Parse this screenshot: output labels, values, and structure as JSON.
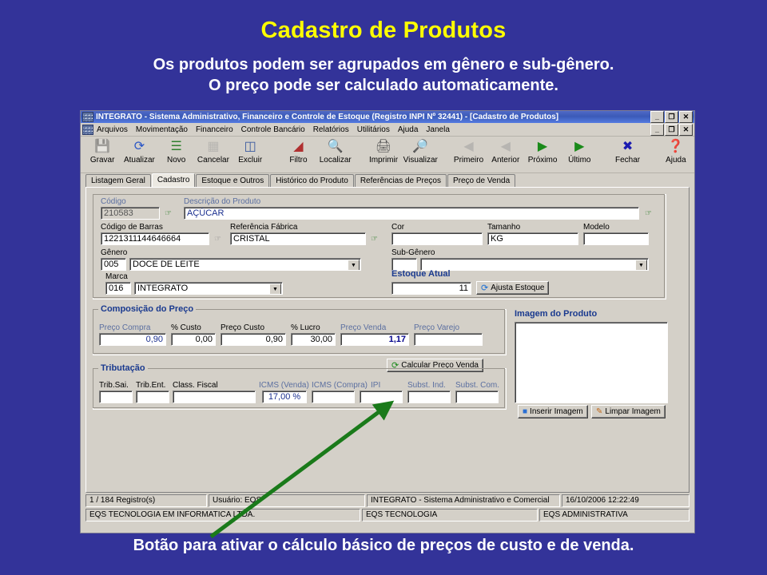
{
  "slide": {
    "title": "Cadastro de Produtos",
    "subtitle_line1": "Os produtos podem ser agrupados em gênero e sub-gênero.",
    "subtitle_line2": "O preço pode ser calculado automaticamente.",
    "caption": "Botão para ativar o cálculo básico de preços de custo e de venda.",
    "bg_color": "#333399",
    "title_color": "#ffff00",
    "text_color": "#ffffff",
    "arrow_color": "#1a7a1a"
  },
  "window": {
    "title": "INTEGRATO - Sistema Administrativo, Financeiro e Controle de Estoque (Registro INPI Nº 32441) - [Cadastro de Produtos]",
    "buttons": {
      "minimize": "_",
      "restore": "❐",
      "close": "✕"
    }
  },
  "menu": {
    "items": [
      "Arquivos",
      "Movimentação",
      "Financeiro",
      "Controle Bancário",
      "Relatórios",
      "Utilitários",
      "Ajuda",
      "Janela"
    ]
  },
  "toolbar": {
    "items": [
      {
        "label": "Gravar",
        "icon": "save-icon",
        "glyph": "🖫",
        "disabled": true
      },
      {
        "label": "Atualizar",
        "icon": "refresh-icon",
        "glyph": "🔄",
        "disabled": false
      },
      {
        "label": "Novo",
        "icon": "new-icon",
        "glyph": "📄",
        "disabled": false
      },
      {
        "label": "Cancelar",
        "icon": "cancel-icon",
        "glyph": "▩",
        "disabled": true
      },
      {
        "label": "Excluir",
        "icon": "delete-icon",
        "glyph": "🗑",
        "disabled": false
      },
      {
        "label": "Filtro",
        "icon": "filter-icon",
        "glyph": "🔻",
        "disabled": false,
        "gap": true
      },
      {
        "label": "Localizar",
        "icon": "search-icon",
        "glyph": "🔍",
        "disabled": false
      },
      {
        "label": "Imprimir",
        "icon": "print-icon",
        "glyph": "🖨",
        "disabled": false,
        "gap": true
      },
      {
        "label": "Visualizar",
        "icon": "preview-icon",
        "glyph": "🔎",
        "disabled": false
      },
      {
        "label": "Primeiro",
        "icon": "first-icon",
        "glyph": "◀",
        "disabled": true,
        "gap": true
      },
      {
        "label": "Anterior",
        "icon": "previous-icon",
        "glyph": "◀",
        "disabled": true
      },
      {
        "label": "Próximo",
        "icon": "next-icon",
        "glyph": "▶",
        "disabled": false
      },
      {
        "label": "Último",
        "icon": "last-icon",
        "glyph": "▶",
        "disabled": false
      },
      {
        "label": "Fechar",
        "icon": "close-window-icon",
        "glyph": "✖",
        "disabled": false,
        "gap": true
      },
      {
        "label": "Ajuda",
        "icon": "help-icon",
        "glyph": "❓",
        "disabled": false,
        "gap": true
      }
    ]
  },
  "tabs": [
    {
      "label": "Listagem Geral",
      "active": false
    },
    {
      "label": "Cadastro",
      "active": true
    },
    {
      "label": "Estoque e Outros",
      "active": false
    },
    {
      "label": "Histórico do Produto",
      "active": false
    },
    {
      "label": "Referências de Preços",
      "active": false
    },
    {
      "label": "Preço de Venda",
      "active": false
    }
  ],
  "form": {
    "codigo": {
      "label": "Código",
      "value": "210583"
    },
    "descricao": {
      "label": "Descrição do Produto",
      "value": "AÇÚCAR"
    },
    "codigo_barras": {
      "label": "Código de Barras",
      "value": "1221311144646664"
    },
    "referencia_fabrica": {
      "label": "Referência Fábrica",
      "value": "CRISTAL"
    },
    "cor": {
      "label": "Cor",
      "value": ""
    },
    "tamanho": {
      "label": "Tamanho",
      "value": "KG"
    },
    "modelo": {
      "label": "Modelo",
      "value": ""
    },
    "genero": {
      "label": "Gênero",
      "code": "005",
      "value": "DOCE DE LEITE"
    },
    "subgenero": {
      "label": "Sub-Gênero",
      "code": "",
      "value": ""
    },
    "marca": {
      "label": "Marca",
      "code": "016",
      "value": "INTEGRATO"
    },
    "estoque_atual": {
      "label": "Estoque Atual",
      "value": "11",
      "button": "Ajusta Estoque"
    }
  },
  "composicao": {
    "title": "Composição do Preço",
    "fields": [
      {
        "label": "Preço Compra",
        "value": "0,90",
        "accent": true
      },
      {
        "label": "% Custo",
        "value": "0,00",
        "accent": false
      },
      {
        "label": "Preço Custo",
        "value": "0,90",
        "accent": false
      },
      {
        "label": "% Lucro",
        "value": "30,00",
        "accent": false
      },
      {
        "label": "Preço Venda",
        "value": "1,17",
        "accent": true
      },
      {
        "label": "Preço Varejo",
        "value": "",
        "accent": false
      }
    ]
  },
  "calcular_button": {
    "label": "Calcular Preço Venda",
    "icon": "recalculate-icon"
  },
  "tributacao": {
    "title": "Tributação",
    "fields": [
      {
        "label": "Trib.Sai.",
        "value": ""
      },
      {
        "label": "Trib.Ent.",
        "value": ""
      },
      {
        "label": "Class. Fiscal",
        "value": ""
      },
      {
        "label": "ICMS (Venda)",
        "value": "17,00 %"
      },
      {
        "label": "ICMS (Compra)",
        "value": ""
      },
      {
        "label": "IPI",
        "value": ""
      },
      {
        "label": "Subst. Ind.",
        "value": ""
      },
      {
        "label": "Subst. Com.",
        "value": ""
      }
    ]
  },
  "imagem": {
    "title": "Imagem do Produto",
    "insert_button": "Inserir Imagem",
    "clear_button": "Limpar Imagem"
  },
  "statusbar": {
    "records": "1 / 184 Registro(s)",
    "user": "Usuário: EQS",
    "system": "INTEGRATO - Sistema Administrativo e Comercial",
    "datetime": "16/10/2006 12:22:49"
  },
  "statusbar2": {
    "company": "EQS TECNOLOGIA EM INFORMATICA LTDA.",
    "unit": "EQS TECNOLOGIA",
    "module": "EQS ADMINISTRATIVA"
  }
}
